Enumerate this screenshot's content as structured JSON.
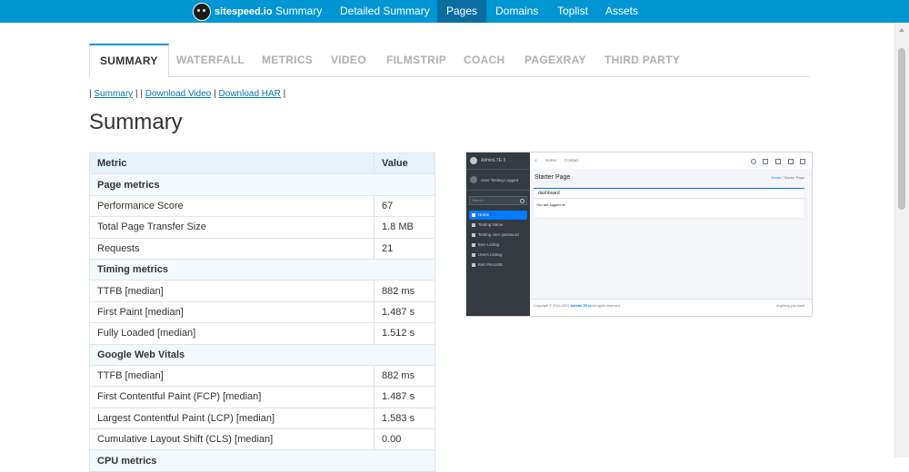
{
  "nav": {
    "brand": "sitespeed.io",
    "items": [
      "Summary",
      "Detailed Summary",
      "Pages",
      "Domains",
      "Toplist",
      "Assets"
    ],
    "active": "Pages"
  },
  "tabs": [
    "SUMMARY",
    "WATERFALL",
    "METRICS",
    "VIDEO",
    "FILMSTRIP",
    "COACH",
    "PAGEXRAY",
    "THIRD PARTY"
  ],
  "links": {
    "summary": "Summary",
    "download_video": "Download Video",
    "download_har": "Download HAR"
  },
  "title": "Summary",
  "table": {
    "headers": [
      "Metric",
      "Value"
    ],
    "groups": [
      {
        "name": "Page metrics",
        "rows": [
          [
            "Performance Score",
            "67"
          ],
          [
            "Total Page Transfer Size",
            "1.8 MB"
          ],
          [
            "Requests",
            "21"
          ]
        ]
      },
      {
        "name": "Timing metrics",
        "rows": [
          [
            "TTFB [median]",
            "882 ms"
          ],
          [
            "First Paint [median]",
            "1.487 s"
          ],
          [
            "Fully Loaded [median]",
            "1.512 s"
          ]
        ]
      },
      {
        "name": "Google Web Vitals",
        "rows": [
          [
            "TTFB [median]",
            "882 ms"
          ],
          [
            "First Contentful Paint (FCP) [median]",
            "1.487 s"
          ],
          [
            "Largest Contentful Paint (LCP) [median]",
            "1.583 s"
          ],
          [
            "Cumulative Layout Shift (CLS) [median]",
            "0.00"
          ]
        ]
      },
      {
        "name": "CPU metrics",
        "rows": []
      }
    ]
  },
  "screenshot": {
    "brand": "AdminLTE 3",
    "user": "User Testing Logged",
    "search_placeholder": "Search",
    "sidebar_items": [
      "Home",
      "Testing Name",
      "Testing user password",
      "Item Listing",
      "Users Listing",
      "Item Records"
    ],
    "top_links": [
      "Home",
      "Contact"
    ],
    "heading": "Starter Page",
    "breadcrumb_home": "Home",
    "breadcrumb_current": "/ Starter Page",
    "card_title": "dashboard",
    "card_body": "You are logged in!",
    "footer_left_prefix": "Copyright © 2014-2021",
    "footer_brand": "AdminLTE.io",
    "footer_left_suffix": "All rights reserved.",
    "footer_right": "Anything you want"
  }
}
